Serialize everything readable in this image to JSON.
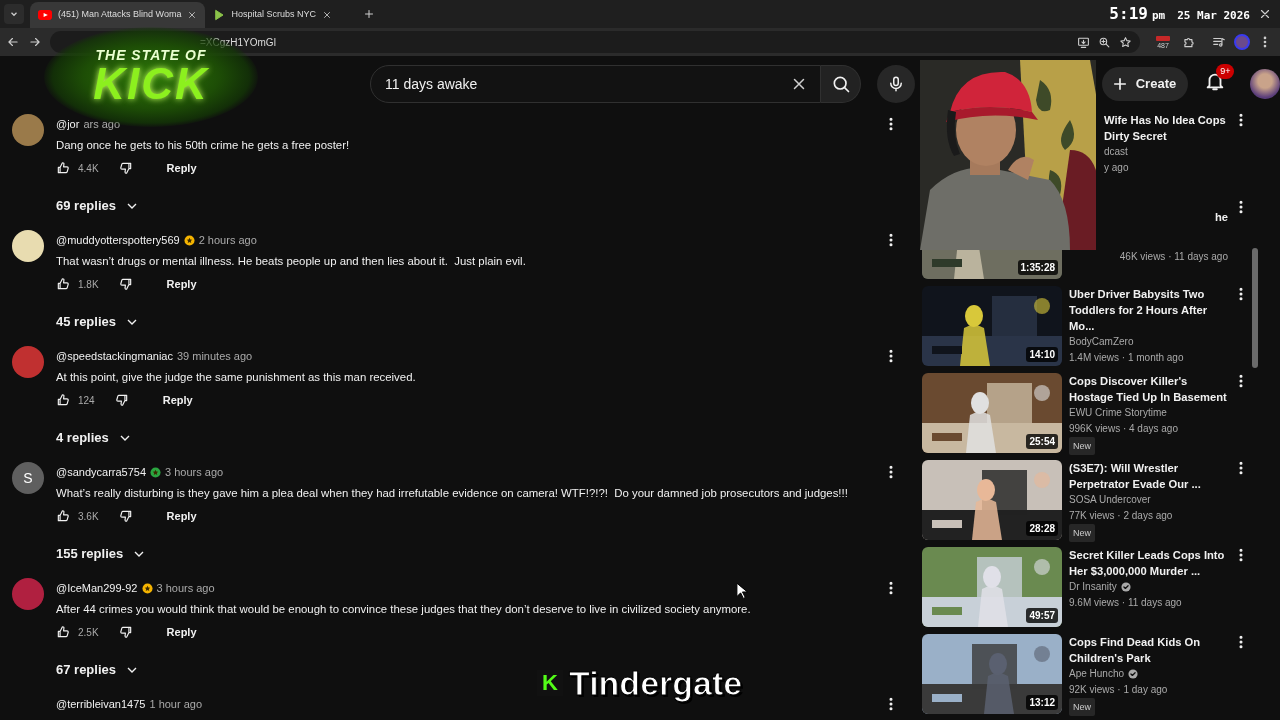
{
  "browser": {
    "tabs": [
      {
        "title": "(451) Man Attacks Blind Woma",
        "kind": "video",
        "selected": true
      },
      {
        "title": "Hospital Scrubs NYC",
        "kind": "play",
        "selected": false
      }
    ],
    "clock": {
      "time": "5:19",
      "ampm": "pm",
      "date": "25 Mar 2026"
    },
    "url": "=XCgzH1YOmGl",
    "extension_badge": "487"
  },
  "overlay_logo": {
    "line_1": "THE STATE OF",
    "line_2": "KICK"
  },
  "header": {
    "search": {
      "value": "11 days awake"
    },
    "create": "Create",
    "notifications": "9+"
  },
  "comments": [
    {
      "handle": "@jor",
      "time": "ars ago",
      "text": "Dang once he gets to his 50th crime he gets a free poster!",
      "likes": "4.4K",
      "reply": "Reply",
      "replies": "69 replies",
      "color": "#9a7a4a"
    },
    {
      "handle": "@muddyotterspottery569",
      "badge": {
        "color": "#f5b400"
      },
      "time": "2 hours ago",
      "text": "That wasn’t drugs or mental illness. He beats people up and then lies about it.  Just plain evil.",
      "likes": "1.8K",
      "reply": "Reply",
      "replies": "45 replies",
      "color": "#e8dcb0"
    },
    {
      "handle": "@speedstackingmaniac",
      "time": "39 minutes ago",
      "text": "At this point, give the judge the same punishment as this man received.",
      "likes": "124",
      "reply": "Reply",
      "replies": "4 replies",
      "color": "#c03030"
    },
    {
      "handle": "@sandycarra5754",
      "badge": {
        "color": "#2ba640"
      },
      "time": "3 hours ago",
      "text": "What’s really disturbing is they gave him a plea deal when they had irrefutable evidence on camera! WTF!?!?!  Do your damned job prosecutors and judges!!!",
      "likes": "3.6K",
      "reply": "Reply",
      "replies": "155 replies",
      "color": "#5f5f5f",
      "avatar_letter": "S"
    },
    {
      "handle": "@IceMan299-92",
      "badge": {
        "color": "#f5b400"
      },
      "time": "3 hours ago",
      "text": "After 44 crimes you would think that would be enough to convince these judges that they don’t deserve to live in civilized society anymore.",
      "likes": "2.5K",
      "reply": "Reply",
      "replies": "67 replies",
      "color": "#b02040"
    },
    {
      "handle": "@terribleivan1475",
      "time": "1 hour ago"
    }
  ],
  "sidebar": [
    {
      "kind": "covered",
      "title": "Wife Has No Idea Cops Dirty Secret",
      "channel": "dcast",
      "meta": "y ago"
    },
    {
      "kind": "covered",
      "title": "he",
      "duration": "1:35:28",
      "meta": "46K views · 11 days ago"
    },
    {
      "kind": "full",
      "title": "Uber Driver Babysits Two Toddlers for 2 Hours After Mo...",
      "channel": "BodyCamZero",
      "duration": "14:10",
      "meta": "1.4M views · 1 month ago"
    },
    {
      "kind": "full",
      "title": "Cops Discover Killer's Hostage Tied Up In Basement",
      "channel": "EWU Crime Storytime",
      "duration": "25:54",
      "meta": "996K views · 4 days ago",
      "new": "New"
    },
    {
      "kind": "full",
      "title": "(S3E7): Will Wrestler Perpetrator Evade Our ...",
      "channel": "SOSA Undercover",
      "duration": "28:28",
      "meta": "77K views · 2 days ago",
      "new": "New"
    },
    {
      "kind": "full",
      "title": "Secret Killer Leads Cops Into Her $3,000,000 Murder ...",
      "channel": "Dr Insanity",
      "verified": true,
      "duration": "49:57",
      "meta": "9.6M views · 11 days ago"
    },
    {
      "kind": "full",
      "title": "Cops Find Dead Kids On Children's Park",
      "channel": "Ape Huncho",
      "verified": true,
      "duration": "13:12",
      "meta": "92K views · 1 day ago",
      "new": "New"
    }
  ],
  "caption": {
    "logo": "K",
    "text": "Tindergate"
  }
}
